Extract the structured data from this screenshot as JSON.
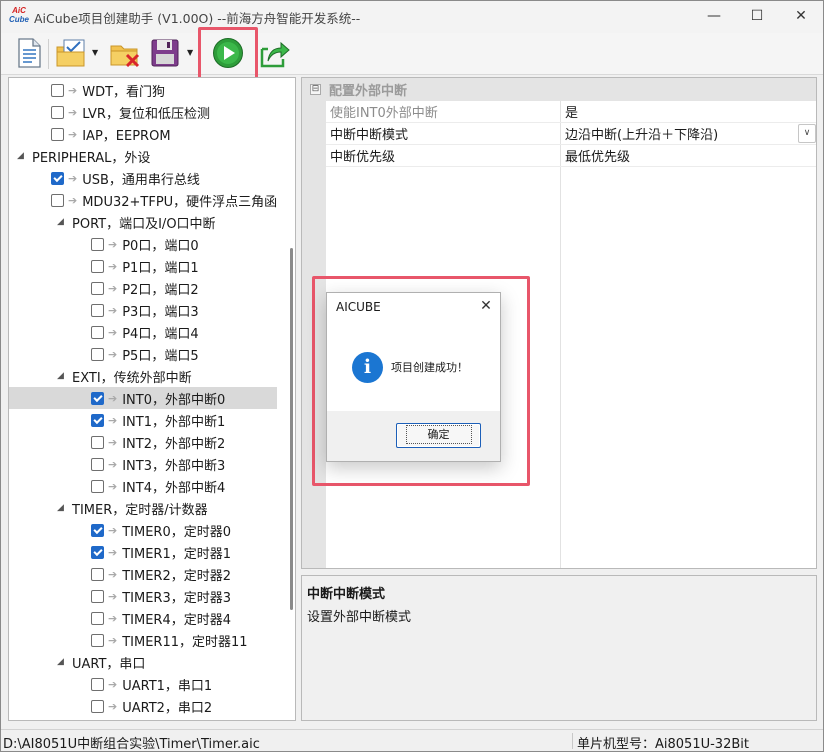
{
  "window": {
    "title": "AiCube项目创建助手 (V1.00O) --前海方舟智能开发系统--",
    "logo_top": "AiC",
    "logo_bottom": "Cube",
    "minimize_glyph": "—",
    "maximize_glyph": "☐",
    "close_glyph": "✕"
  },
  "toolbar": {
    "buttons": [
      {
        "name": "new-project",
        "icon": "document-icon"
      },
      {
        "name": "open-project",
        "icon": "folder-check-icon",
        "dropdown": true
      },
      {
        "name": "close-project",
        "icon": "folder-delete-icon"
      },
      {
        "name": "save-project",
        "icon": "floppy-disk-icon",
        "dropdown": true
      },
      {
        "name": "generate",
        "icon": "play-icon",
        "highlighted": true
      },
      {
        "name": "export",
        "icon": "share-arrow-icon"
      }
    ],
    "highlight_color": "#e8566a"
  },
  "tree": {
    "rows": [
      {
        "label": "WDT，看门狗",
        "checked": false
      },
      {
        "label": "LVR，复位和低压检测",
        "checked": false
      },
      {
        "label": "IAP，EEPROM",
        "checked": false
      },
      {
        "label": "PERIPHERAL，外设",
        "expander": "◢"
      },
      {
        "label": "USB，通用串行总线",
        "checked": true
      },
      {
        "label": "MDU32+TFPU，硬件浮点三角函",
        "checked": false
      },
      {
        "label": "PORT，端口及I/O口中断",
        "expander": "◢"
      },
      {
        "label": "P0口，端口0",
        "checked": false
      },
      {
        "label": "P1口，端口1",
        "checked": false
      },
      {
        "label": "P2口，端口2",
        "checked": false
      },
      {
        "label": "P3口，端口3",
        "checked": false
      },
      {
        "label": "P4口，端口4",
        "checked": false
      },
      {
        "label": "P5口，端口5",
        "checked": false
      },
      {
        "label": "EXTI，传统外部中断",
        "expander": "◢"
      },
      {
        "label": "INT0，外部中断0",
        "checked": true,
        "selected": true
      },
      {
        "label": "INT1，外部中断1",
        "checked": true
      },
      {
        "label": "INT2，外部中断2",
        "checked": false
      },
      {
        "label": "INT3，外部中断3",
        "checked": false
      },
      {
        "label": "INT4，外部中断4",
        "checked": false
      },
      {
        "label": "TIMER，定时器/计数器",
        "expander": "◢"
      },
      {
        "label": "TIMER0，定时器0",
        "checked": true
      },
      {
        "label": "TIMER1，定时器1",
        "checked": true
      },
      {
        "label": "TIMER2，定时器2",
        "checked": false
      },
      {
        "label": "TIMER3，定时器3",
        "checked": false
      },
      {
        "label": "TIMER4，定时器4",
        "checked": false
      },
      {
        "label": "TIMER11，定时器11",
        "checked": false
      },
      {
        "label": "UART，串口",
        "expander": "◢"
      },
      {
        "label": "UART1，串口1",
        "checked": false
      },
      {
        "label": "UART2，串口2",
        "checked": false
      }
    ]
  },
  "properties": {
    "category": "配置外部中断",
    "collapse_glyph": "⊟",
    "rows": [
      {
        "name": "使能INT0外部中断",
        "value": "是",
        "dim": true
      },
      {
        "name": "中断中断模式",
        "value": "边沿中断(上升沿＋下降沿)",
        "dropdown": true
      },
      {
        "name": "中断优先级",
        "value": "最低优先级"
      }
    ]
  },
  "description": {
    "title": "中断中断模式",
    "text": "设置外部中断模式"
  },
  "statusbar": {
    "path": "D:\\AI8051U中断组合实验\\Timer\\Timer.aic",
    "mcu": "单片机型号：Ai8051U-32Bit"
  },
  "dialog": {
    "title": "AICUBE",
    "message": "项目创建成功！",
    "ok_label": "确定",
    "icon": "info-icon",
    "icon_glyph": "i",
    "close_glyph": "✕"
  }
}
